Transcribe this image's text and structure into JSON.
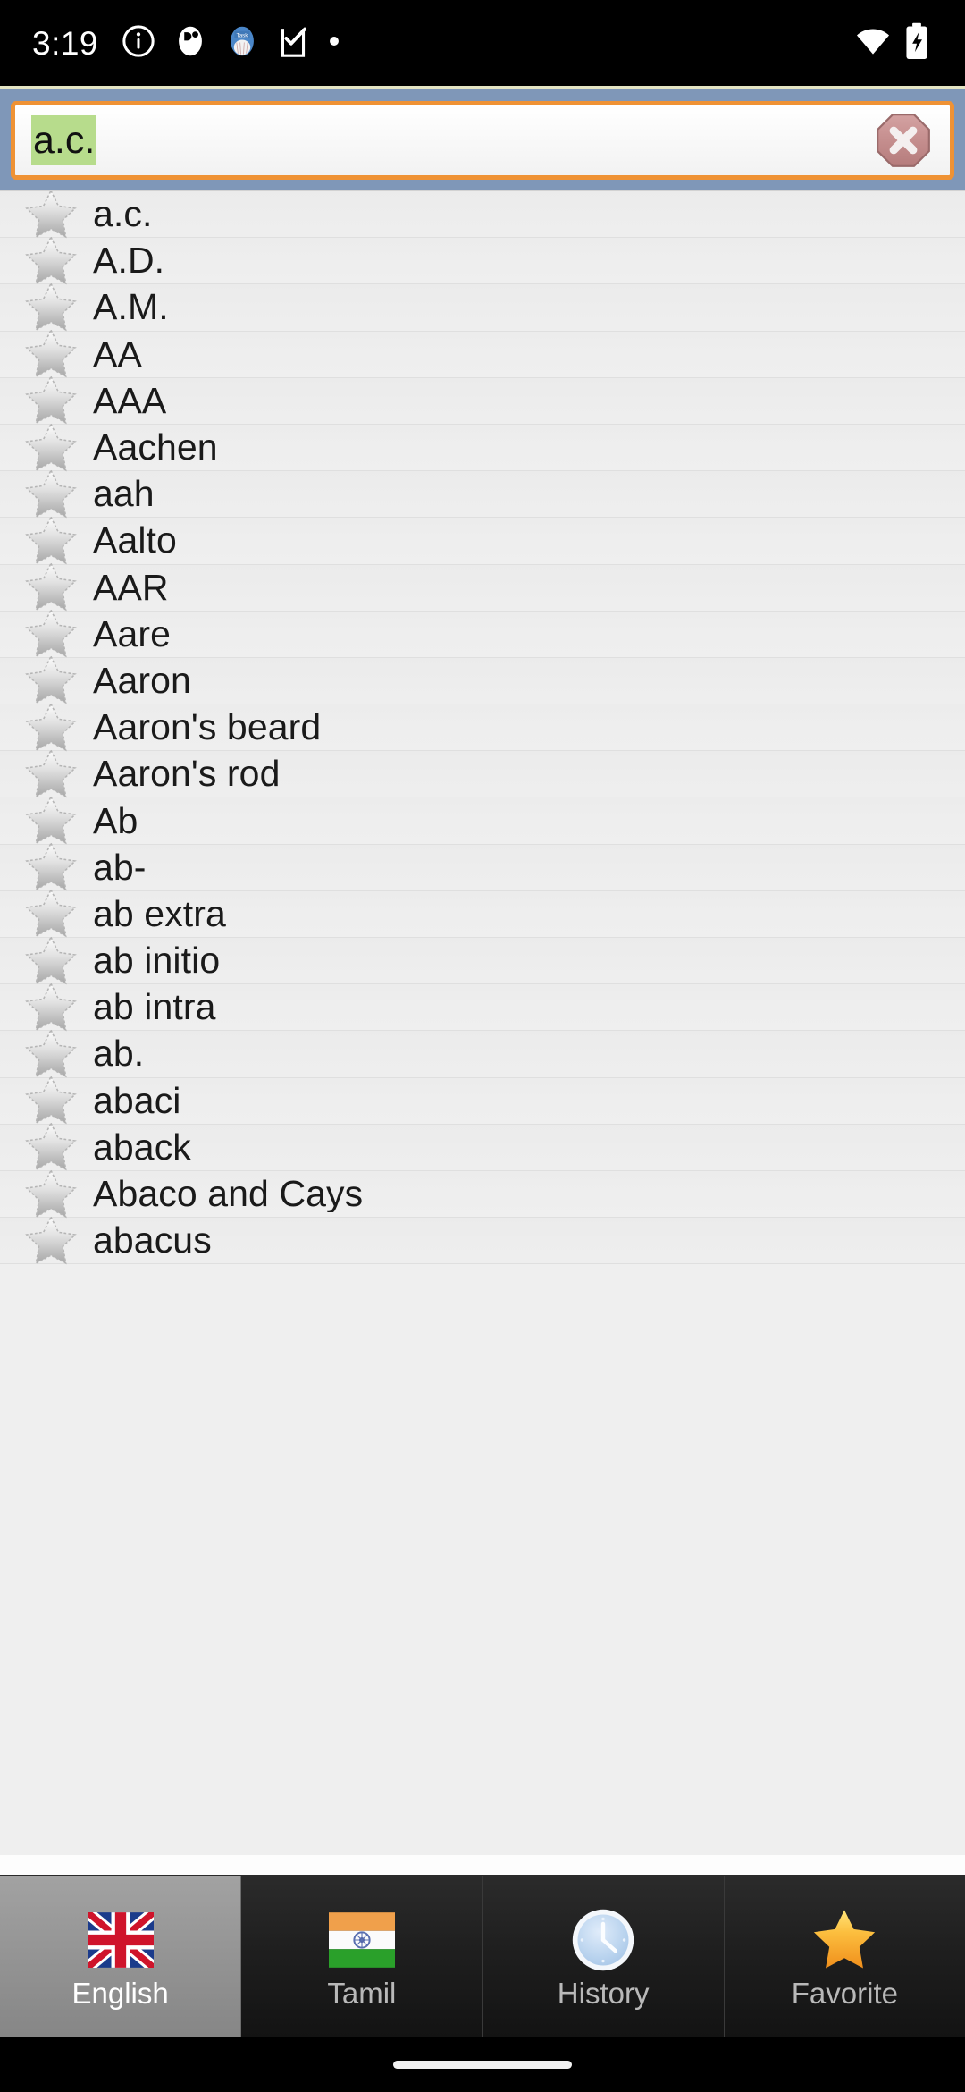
{
  "status_bar": {
    "time": "3:19",
    "left_icons": [
      "info-icon",
      "app-notification-icon",
      "taskbucks-notification-icon",
      "checkmark-task-icon",
      "dot-icon"
    ],
    "right_icons": [
      "wifi-icon",
      "battery-charging-icon"
    ]
  },
  "search": {
    "value": "a.c.",
    "placeholder": "Search",
    "clear_icon": "clear-octagon-icon",
    "accent_border": "#ef9234",
    "header_bg": "#7f97b8",
    "selection_color": "#b7dc8c"
  },
  "word_list": {
    "star_icon": "star-outline-gray-icon",
    "items": [
      {
        "word": "a.c."
      },
      {
        "word": "A.D."
      },
      {
        "word": "A.M."
      },
      {
        "word": "AA"
      },
      {
        "word": "AAA"
      },
      {
        "word": "Aachen"
      },
      {
        "word": "aah"
      },
      {
        "word": "Aalto"
      },
      {
        "word": "AAR"
      },
      {
        "word": "Aare"
      },
      {
        "word": "Aaron"
      },
      {
        "word": "Aaron's beard"
      },
      {
        "word": "Aaron's rod"
      },
      {
        "word": "Ab"
      },
      {
        "word": "ab-"
      },
      {
        "word": "ab extra"
      },
      {
        "word": "ab initio"
      },
      {
        "word": "ab intra"
      },
      {
        "word": "ab."
      },
      {
        "word": "abaci"
      },
      {
        "word": "aback"
      },
      {
        "word": "Abaco and Cays"
      },
      {
        "word": "abacus"
      }
    ]
  },
  "tabbar": {
    "tabs": [
      {
        "label": "English",
        "icon": "uk-flag-icon",
        "selected": true
      },
      {
        "label": "Tamil",
        "icon": "india-flag-icon",
        "selected": false
      },
      {
        "label": "History",
        "icon": "clock-icon",
        "selected": false
      },
      {
        "label": "Favorite",
        "icon": "gold-star-icon",
        "selected": false
      }
    ]
  }
}
